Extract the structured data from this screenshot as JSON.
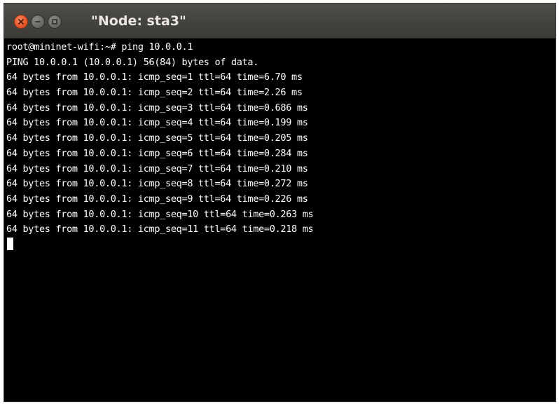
{
  "window": {
    "title": "\"Node: sta3\"",
    "buttons": {
      "close_icon": "close-icon",
      "minimize_icon": "minimize-icon",
      "maximize_icon": "maximize-icon"
    },
    "accent_close": "#e9592c"
  },
  "terminal": {
    "lines": [
      "root@mininet-wifi:~# ping 10.0.0.1",
      "PING 10.0.0.1 (10.0.0.1) 56(84) bytes of data.",
      "64 bytes from 10.0.0.1: icmp_seq=1 ttl=64 time=6.70 ms",
      "64 bytes from 10.0.0.1: icmp_seq=2 ttl=64 time=2.26 ms",
      "64 bytes from 10.0.0.1: icmp_seq=3 ttl=64 time=0.686 ms",
      "64 bytes from 10.0.0.1: icmp_seq=4 ttl=64 time=0.199 ms",
      "64 bytes from 10.0.0.1: icmp_seq=5 ttl=64 time=0.205 ms",
      "64 bytes from 10.0.0.1: icmp_seq=6 ttl=64 time=0.284 ms",
      "64 bytes from 10.0.0.1: icmp_seq=7 ttl=64 time=0.210 ms",
      "64 bytes from 10.0.0.1: icmp_seq=8 ttl=64 time=0.272 ms",
      "64 bytes from 10.0.0.1: icmp_seq=9 ttl=64 time=0.226 ms",
      "64 bytes from 10.0.0.1: icmp_seq=10 ttl=64 time=0.263 ms",
      "64 bytes from 10.0.0.1: icmp_seq=11 ttl=64 time=0.218 ms"
    ],
    "background": "#000000",
    "foreground": "#ffffff"
  }
}
